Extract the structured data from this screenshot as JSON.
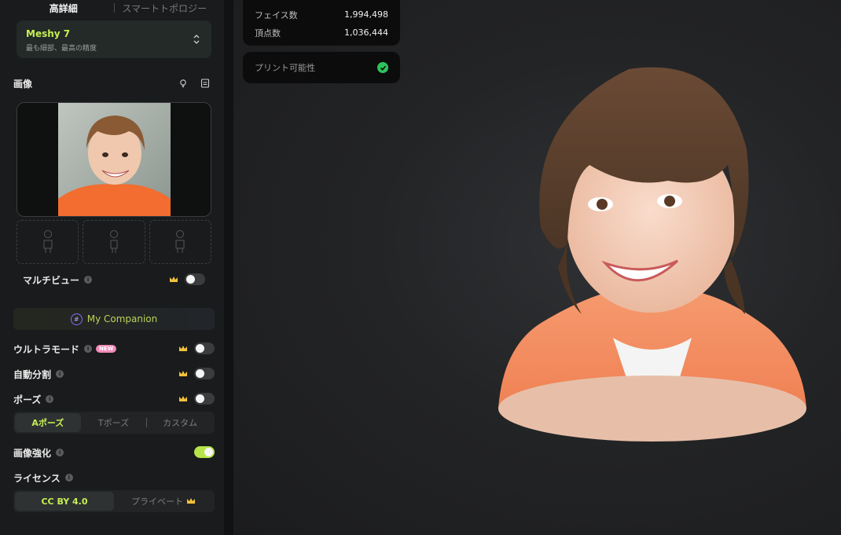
{
  "left_panel": {
    "quality_tabs": [
      {
        "label": "高詳細",
        "active": true
      },
      {
        "label": "スマートトポロジー",
        "active": false
      }
    ],
    "model": {
      "name": "Meshy 7",
      "description": "最も細部、最高の精度"
    },
    "image_section": {
      "title": "画像"
    },
    "multiview": {
      "label": "マルチビュー",
      "enabled": false
    },
    "companion": {
      "label": "My Companion",
      "icon": "#"
    },
    "options": [
      {
        "label": "ウルトラモード",
        "badge": "NEW",
        "premium": true,
        "enabled": false
      },
      {
        "label": "自動分割",
        "premium": true,
        "enabled": false
      },
      {
        "label": "ポーズ",
        "premium": true,
        "enabled": false
      }
    ],
    "pose_modes": [
      {
        "label": "Aポーズ",
        "active": true
      },
      {
        "label": "Tポーズ",
        "active": false
      },
      {
        "label": "カスタム",
        "active": false
      }
    ],
    "image_enhance": {
      "label": "画像強化",
      "enabled": true
    },
    "license": {
      "label": "ライセンス",
      "options": [
        {
          "label": "CC BY 4.0",
          "active": true
        },
        {
          "label": "プライベート",
          "active": false,
          "premium": true
        }
      ]
    }
  },
  "stats": {
    "faces_label": "フェイス数",
    "faces_value": "1,994,498",
    "vertices_label": "頂点数",
    "vertices_value": "1,036,444"
  },
  "printability": {
    "label": "プリント可能性",
    "status": "ok"
  },
  "colors": {
    "accent": "#c5ef53",
    "toggle_on": "#b7e34a",
    "success": "#2fc25b",
    "badge_new": "#f08bb8",
    "crown": "#f2c23a"
  }
}
